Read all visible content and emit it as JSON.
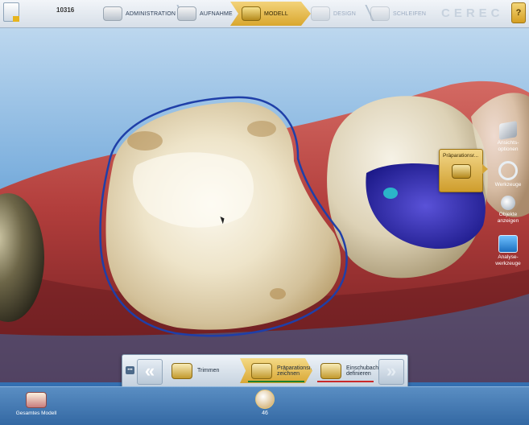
{
  "header": {
    "case_id": "10316",
    "steps": [
      {
        "label": "ADMINISTRATION",
        "state": "done"
      },
      {
        "label": "AUFNAHME",
        "state": "done"
      },
      {
        "label": "MODELL",
        "state": "active"
      },
      {
        "label": "DESIGN",
        "state": "disabled"
      },
      {
        "label": "SCHLEIFEN",
        "state": "disabled"
      }
    ],
    "brand": "CEREC",
    "help_label": "?"
  },
  "side_tools": {
    "ansicht_line1": "Ansichts-",
    "ansicht_line2": "optionen",
    "werkzeuge": "Werkzeuge",
    "objekte_line1": "Objekte",
    "objekte_line2": "anzeigen",
    "analyse_line1": "Analyse-",
    "analyse_line2": "werkzeuge"
  },
  "popup": {
    "title": "Präparationsr..."
  },
  "step_bar": {
    "trimmen": "Trimmen",
    "praep_line1": "Präparationsrand",
    "praep_line2": "zeichnen",
    "einsch_line1": "Einschubachse",
    "einsch_line2": "definieren"
  },
  "tray": {
    "gesamt": "Gesamtes Modell",
    "tooth_number": "46"
  },
  "colors": {
    "accent_gold": "#d9a72e",
    "margin_line": "#1f3fa8",
    "tray_blue": "#3368a3"
  }
}
